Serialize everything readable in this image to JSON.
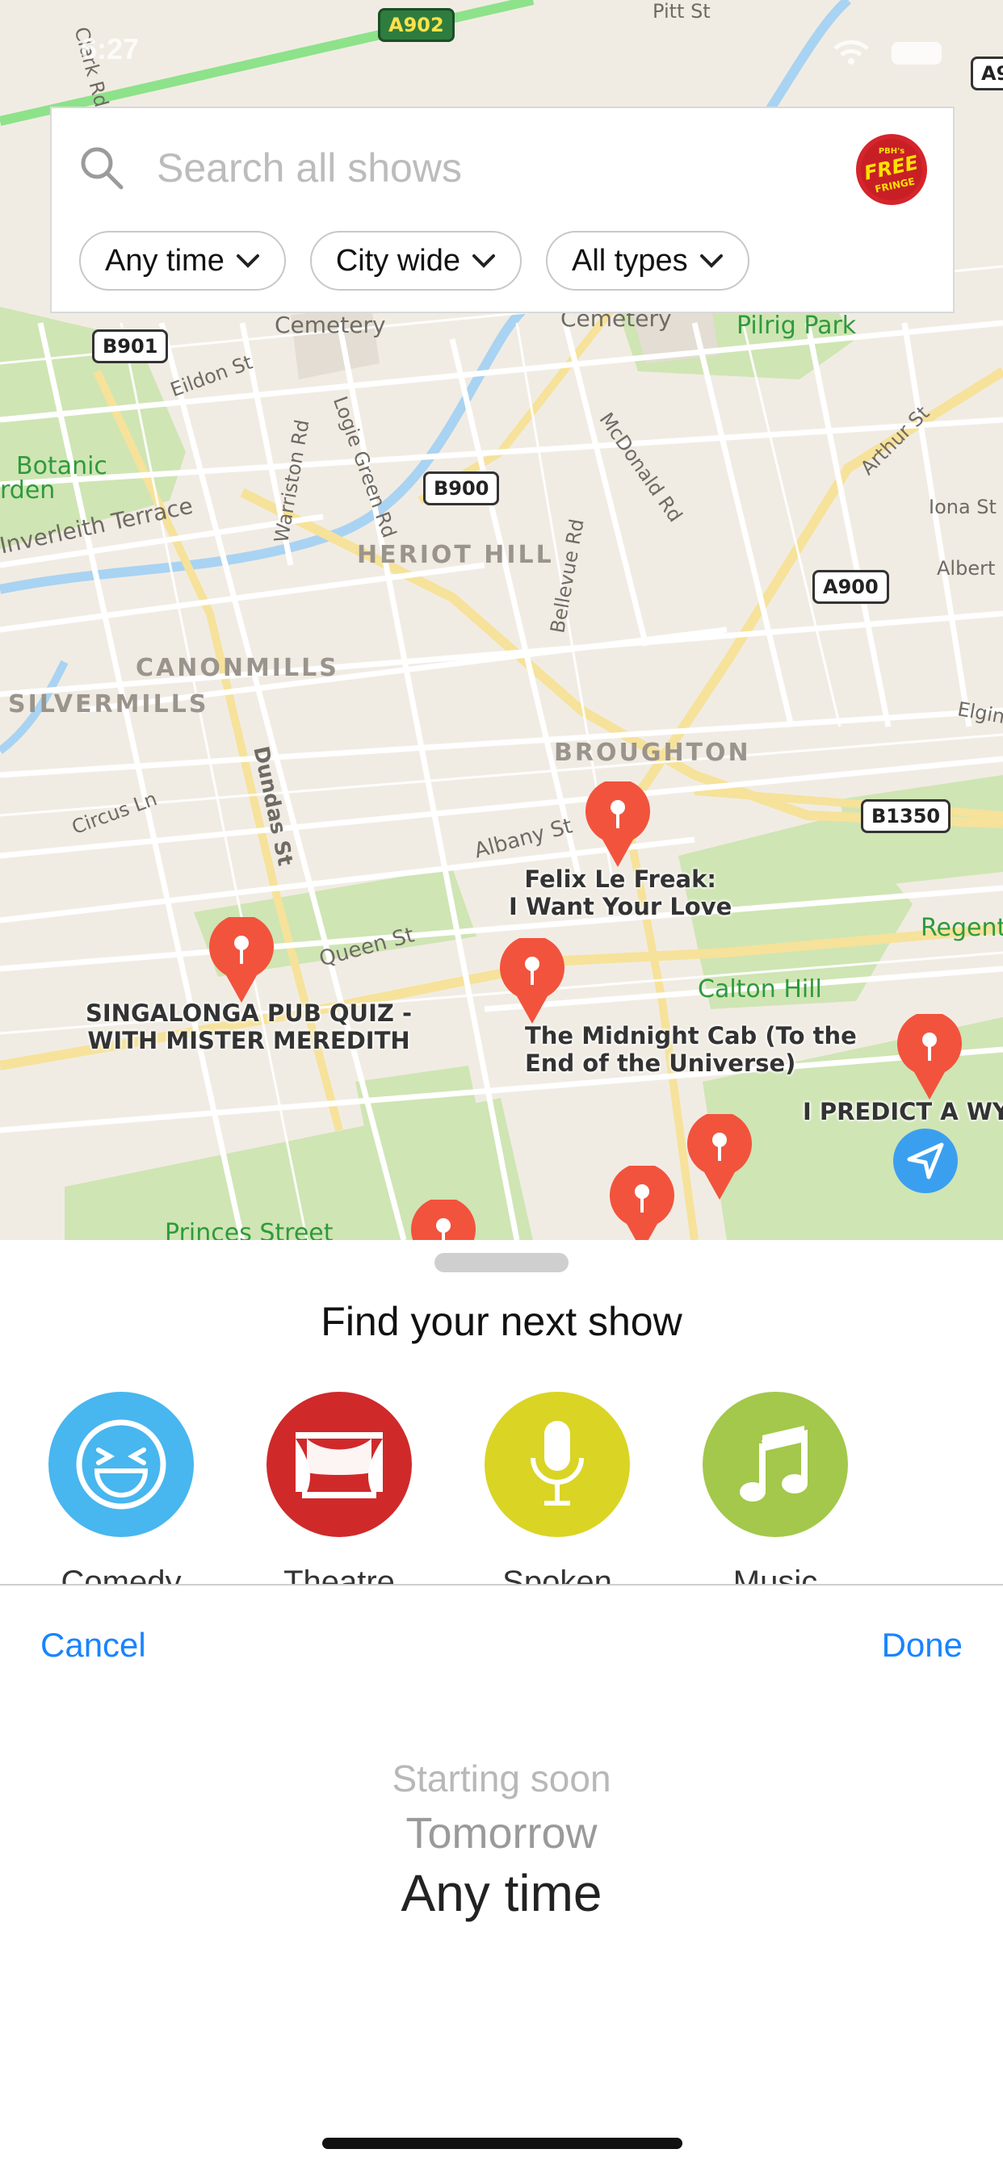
{
  "status": {
    "time": "6:27"
  },
  "map": {
    "areas": [
      "HERIOT HILL",
      "CANONMILLS",
      "SILVERMILLS",
      "BROUGHTON"
    ],
    "roads": [
      "A902",
      "B901",
      "B900",
      "A900",
      "B1350",
      "A9"
    ],
    "streets": [
      "Clark Rd",
      "Pitt St",
      "Eildon St",
      "Logie Green Rd",
      "Warriston Rd",
      "McDonald Rd",
      "Arthur St",
      "Iona St",
      "Albert",
      "Bellevue Rd",
      "Inverleith Terrace",
      "Circus Ln",
      "Dundas St",
      "Albany St",
      "Queen St",
      "Elgin"
    ],
    "parks": [
      "Cemetery",
      "Cemetery",
      "Pilrig Park",
      "Botanic",
      "rden",
      "Calton Hill",
      "Regent",
      "Princes Street"
    ],
    "shows": [
      {
        "title_line1": "Felix Le Freak:",
        "title_line2": "I Want Your Love"
      },
      {
        "title_line1": "SINGALONGA PUB QUIZ -",
        "title_line2": "WITH MISTER MEREDITH"
      },
      {
        "title_line1": "The Midnight Cab (To the",
        "title_line2": "End of the Universe)"
      },
      {
        "title_line1": "I PREDICT A WYA",
        "title_line2": ""
      }
    ],
    "pin_color": "#f2533d",
    "location_button_color": "#3b9ff0"
  },
  "search": {
    "placeholder": "Search all shows",
    "logo_line1": "PBH's",
    "logo_line2": "FREE",
    "logo_line3": "FRINGE",
    "filters": [
      {
        "label": "Any time"
      },
      {
        "label": "City wide"
      },
      {
        "label": "All types"
      }
    ]
  },
  "sheet": {
    "title": "Find your next show",
    "categories": [
      {
        "label": "Comedy",
        "color": "#48b6ef",
        "icon": "laughing-face-icon"
      },
      {
        "label": "Theatre",
        "color": "#d0292a",
        "icon": "stage-curtain-icon"
      },
      {
        "label": "Spoken word",
        "color": "#dad424",
        "icon": "microphone-icon"
      },
      {
        "label": "Music",
        "color": "#a3c84b",
        "icon": "music-note-icon"
      }
    ]
  },
  "picker": {
    "cancel": "Cancel",
    "done": "Done",
    "options": [
      "Starting soon",
      "Tomorrow",
      "Any time"
    ],
    "selected": "Any time"
  },
  "colors": {
    "accent": "#1a84ff"
  }
}
